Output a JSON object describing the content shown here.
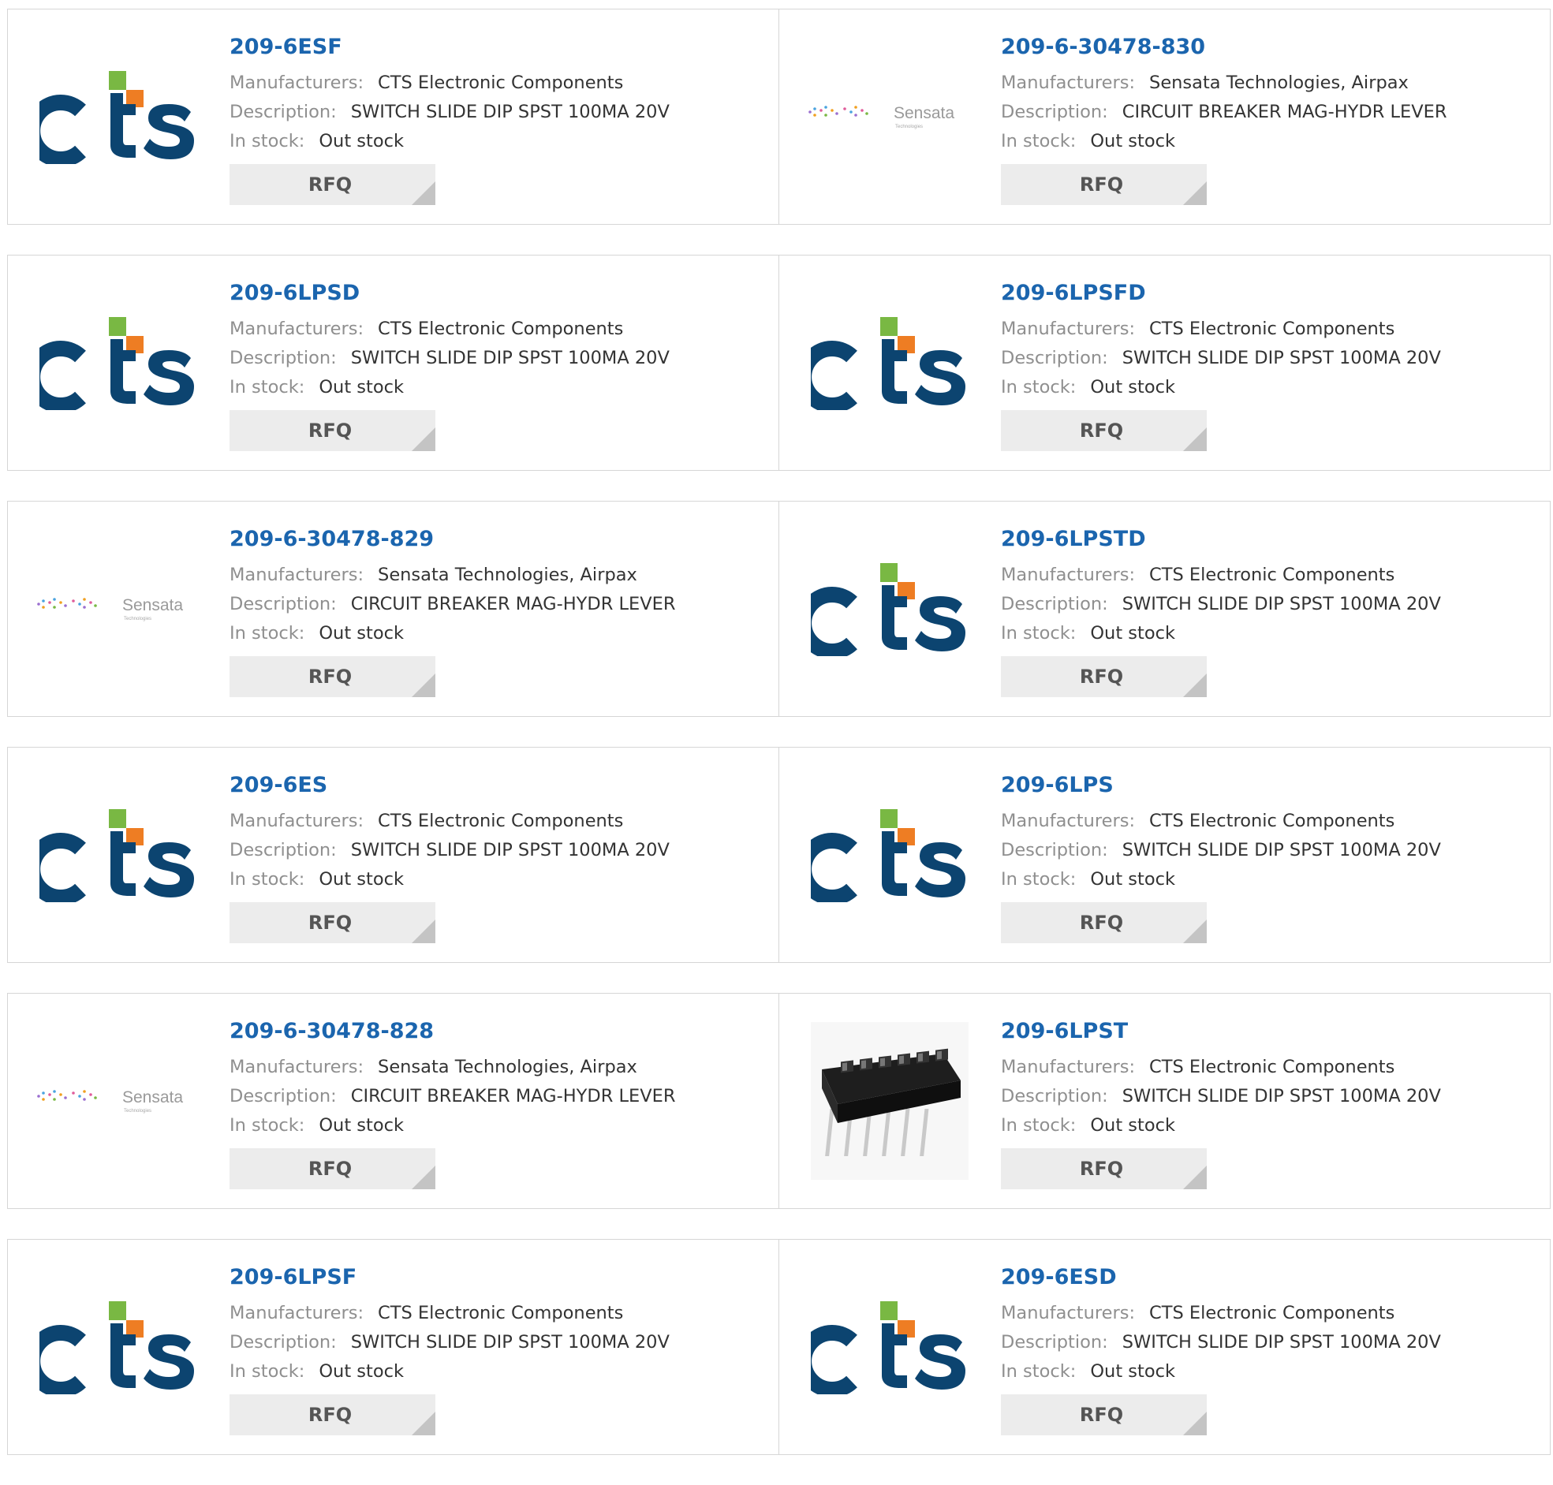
{
  "labels": {
    "manufacturers": "Manufacturers:",
    "description": "Description:",
    "in_stock": "In stock:",
    "rfq": "RFQ"
  },
  "colors": {
    "link": "#1b65ae",
    "cts_navy": "#0c4470",
    "cts_green": "#79b843",
    "cts_orange": "#ee7d23",
    "button_bg": "#ececec"
  },
  "products": [
    {
      "part": "209-6ESF",
      "manufacturer": "CTS Electronic Components",
      "description": "SWITCH SLIDE DIP SPST 100MA 20V",
      "stock": "Out stock",
      "logo": "cts-logo"
    },
    {
      "part": "209-6-30478-830",
      "manufacturer": "Sensata Technologies, Airpax",
      "description": "CIRCUIT BREAKER MAG-HYDR LEVER",
      "stock": "Out stock",
      "logo": "sensata-logo"
    },
    {
      "part": "209-6LPSD",
      "manufacturer": "CTS Electronic Components",
      "description": "SWITCH SLIDE DIP SPST 100MA 20V",
      "stock": "Out stock",
      "logo": "cts-logo"
    },
    {
      "part": "209-6LPSFD",
      "manufacturer": "CTS Electronic Components",
      "description": "SWITCH SLIDE DIP SPST 100MA 20V",
      "stock": "Out stock",
      "logo": "cts-logo"
    },
    {
      "part": "209-6-30478-829",
      "manufacturer": "Sensata Technologies, Airpax",
      "description": "CIRCUIT BREAKER MAG-HYDR LEVER",
      "stock": "Out stock",
      "logo": "sensata-logo"
    },
    {
      "part": "209-6LPSTD",
      "manufacturer": "CTS Electronic Components",
      "description": "SWITCH SLIDE DIP SPST 100MA 20V",
      "stock": "Out stock",
      "logo": "cts-logo"
    },
    {
      "part": "209-6ES",
      "manufacturer": "CTS Electronic Components",
      "description": "SWITCH SLIDE DIP SPST 100MA 20V",
      "stock": "Out stock",
      "logo": "cts-logo"
    },
    {
      "part": "209-6LPS",
      "manufacturer": "CTS Electronic Components",
      "description": "SWITCH SLIDE DIP SPST 100MA 20V",
      "stock": "Out stock",
      "logo": "cts-logo"
    },
    {
      "part": "209-6-30478-828",
      "manufacturer": "Sensata Technologies, Airpax",
      "description": "CIRCUIT BREAKER MAG-HYDR LEVER",
      "stock": "Out stock",
      "logo": "sensata-logo"
    },
    {
      "part": "209-6LPST",
      "manufacturer": "CTS Electronic Components",
      "description": "SWITCH SLIDE DIP SPST 100MA 20V",
      "stock": "Out stock",
      "logo": "dip-switch-photo"
    },
    {
      "part": "209-6LPSF",
      "manufacturer": "CTS Electronic Components",
      "description": "SWITCH SLIDE DIP SPST 100MA 20V",
      "stock": "Out stock",
      "logo": "cts-logo"
    },
    {
      "part": "209-6ESD",
      "manufacturer": "CTS Electronic Components",
      "description": "SWITCH SLIDE DIP SPST 100MA 20V",
      "stock": "Out stock",
      "logo": "cts-logo"
    }
  ],
  "sensata_logo": {
    "wordmark": "Sensata",
    "tagline": "Technologies"
  },
  "cts_logo": {
    "wordmark": "CTS"
  }
}
